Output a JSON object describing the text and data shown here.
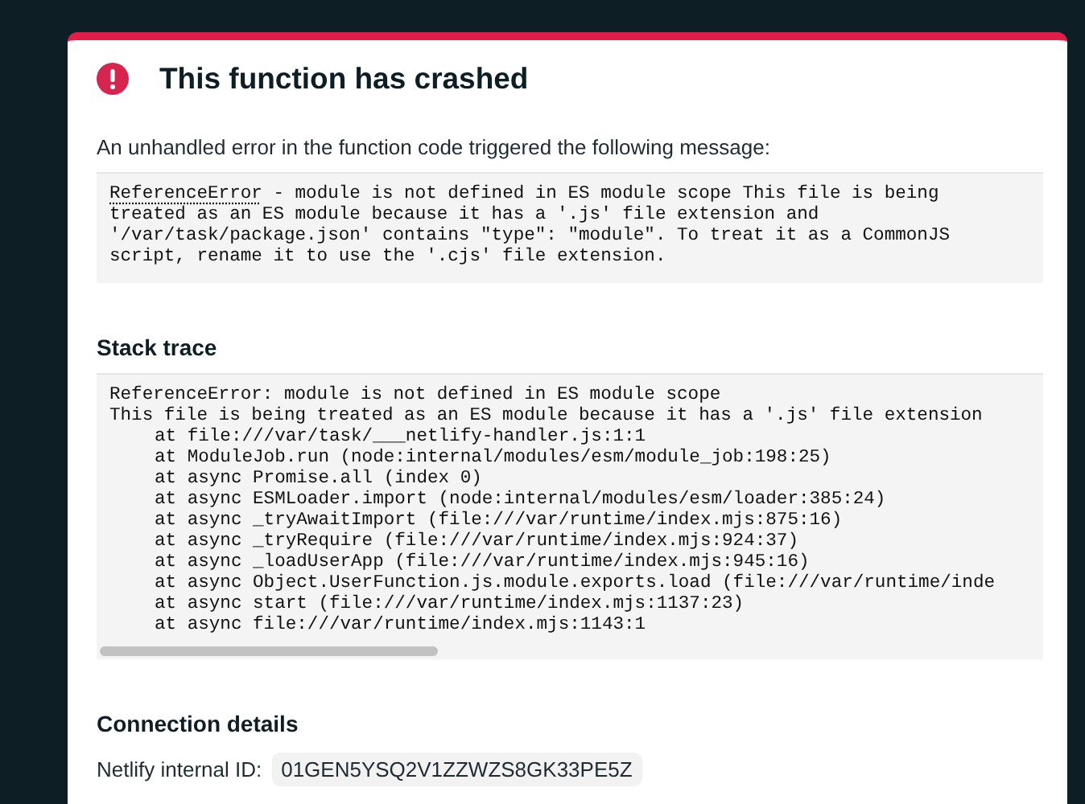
{
  "title": "This function has crashed",
  "intro": "An unhandled error in the function code triggered the following message:",
  "error": {
    "name": "ReferenceError",
    "lines": [
      " - module is not defined in ES module scope This file is being",
      "treated as an ES module because it has a '.js' file extension and",
      "'/var/task/package.json' contains \"type\": \"module\". To treat it as a CommonJS",
      "script, rename it to use the '.cjs' file extension."
    ]
  },
  "stack_trace": {
    "heading": "Stack trace",
    "messages": [
      "ReferenceError: module is not defined in ES module scope",
      "This file is being treated as an ES module because it has a '.js' file extension"
    ],
    "frames": [
      "at file:///var/task/___netlify-handler.js:1:1",
      "at ModuleJob.run (node:internal/modules/esm/module_job:198:25)",
      "at async Promise.all (index 0)",
      "at async ESMLoader.import (node:internal/modules/esm/loader:385:24)",
      "at async _tryAwaitImport (file:///var/runtime/index.mjs:875:16)",
      "at async _tryRequire (file:///var/runtime/index.mjs:924:37)",
      "at async _loadUserApp (file:///var/runtime/index.mjs:945:16)",
      "at async Object.UserFunction.js.module.exports.load (file:///var/runtime/inde",
      "at async start (file:///var/runtime/index.mjs:1137:23)",
      "at async file:///var/runtime/index.mjs:1143:1"
    ]
  },
  "connection": {
    "heading": "Connection details",
    "label": "Netlify internal ID:",
    "value": "01GEN5YSQ2V1ZZWZS8GK33PE5Z"
  }
}
